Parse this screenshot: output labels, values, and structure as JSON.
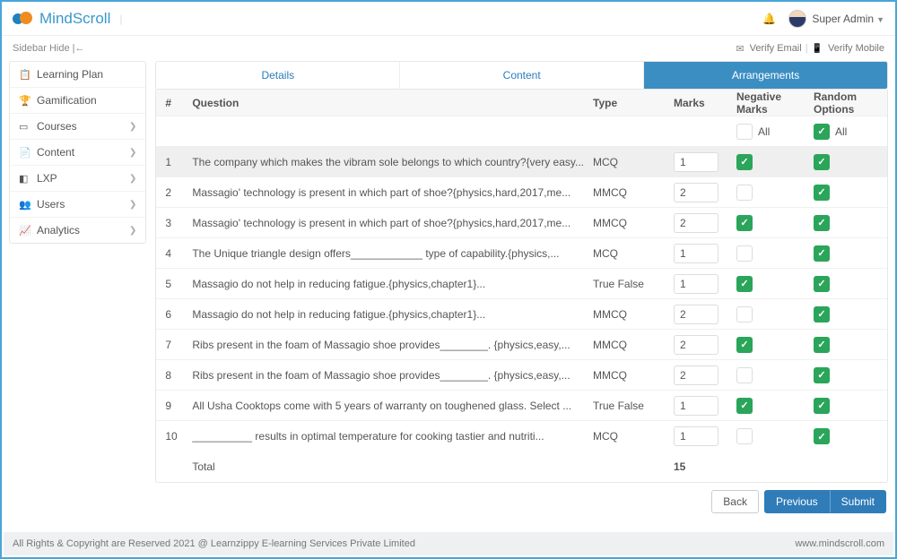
{
  "header": {
    "brand": "MindScroll",
    "user": "Super Admin"
  },
  "subbar": {
    "sidebar_hide": "Sidebar Hide  |←",
    "verify_email": "Verify Email",
    "verify_mobile": "Verify Mobile"
  },
  "sidebar": {
    "items": [
      {
        "icon": "📋",
        "label": "Learning Plan",
        "chev": false
      },
      {
        "icon": "🏆",
        "label": "Gamification",
        "chev": false
      },
      {
        "icon": "▭",
        "label": "Courses",
        "chev": true
      },
      {
        "icon": "📄",
        "label": "Content",
        "chev": true
      },
      {
        "icon": "◧",
        "label": "LXP",
        "chev": true
      },
      {
        "icon": "👥",
        "label": "Users",
        "chev": true
      },
      {
        "icon": "📈",
        "label": "Analytics",
        "chev": true
      }
    ]
  },
  "tabs": {
    "details": "Details",
    "content": "Content",
    "arrangements": "Arrangements"
  },
  "table": {
    "headers": {
      "num": "#",
      "question": "Question",
      "type": "Type",
      "marks": "Marks",
      "neg": "Negative Marks",
      "rand": "Random Options"
    },
    "filter_all": "All",
    "rows": [
      {
        "n": "1",
        "q": "The company which makes the vibram sole belongs to which country?{very easy...",
        "type": "MCQ",
        "marks": "1",
        "neg": true,
        "rand": true,
        "selected": true
      },
      {
        "n": "2",
        "q": "Massagio' technology is present in which part of shoe?{physics,hard,2017,me...",
        "type": "MMCQ",
        "marks": "2",
        "neg": false,
        "rand": true
      },
      {
        "n": "3",
        "q": "Massagio' technology is present in which part of shoe?{physics,hard,2017,me...",
        "type": "MMCQ",
        "marks": "2",
        "neg": true,
        "rand": true
      },
      {
        "n": "4",
        "q": "The Unique triangle design offers____________ type of capability.{physics,...",
        "type": "MCQ",
        "marks": "1",
        "neg": false,
        "rand": true
      },
      {
        "n": "5",
        "q": "Massagio do not help in reducing fatigue.{physics,chapter1}...",
        "type": "True False",
        "marks": "1",
        "neg": true,
        "rand": true
      },
      {
        "n": "6",
        "q": "Massagio do not help in reducing fatigue.{physics,chapter1}...",
        "type": "MMCQ",
        "marks": "2",
        "neg": false,
        "rand": true
      },
      {
        "n": "7",
        "q": "Ribs present in the foam of Massagio shoe provides________. {physics,easy,...",
        "type": "MMCQ",
        "marks": "2",
        "neg": true,
        "rand": true
      },
      {
        "n": "8",
        "q": "Ribs present in the foam of Massagio shoe provides________. {physics,easy,...",
        "type": "MMCQ",
        "marks": "2",
        "neg": false,
        "rand": true
      },
      {
        "n": "9",
        "q": "All Usha Cooktops come with 5 years of warranty on toughened glass. Select ...",
        "type": "True False",
        "marks": "1",
        "neg": true,
        "rand": true
      },
      {
        "n": "10",
        "q": "__________ results in optimal temperature for cooking tastier and nutriti...",
        "type": "MCQ",
        "marks": "1",
        "neg": false,
        "rand": true
      }
    ],
    "total_label": "Total",
    "total_marks": "15"
  },
  "buttons": {
    "back": "Back",
    "previous": "Previous",
    "submit": "Submit"
  },
  "footer": {
    "copyright": "All Rights & Copyright are Reserved 2021 @ Learnzippy E-learning Services Private Limited",
    "site": "www.mindscroll.com"
  }
}
